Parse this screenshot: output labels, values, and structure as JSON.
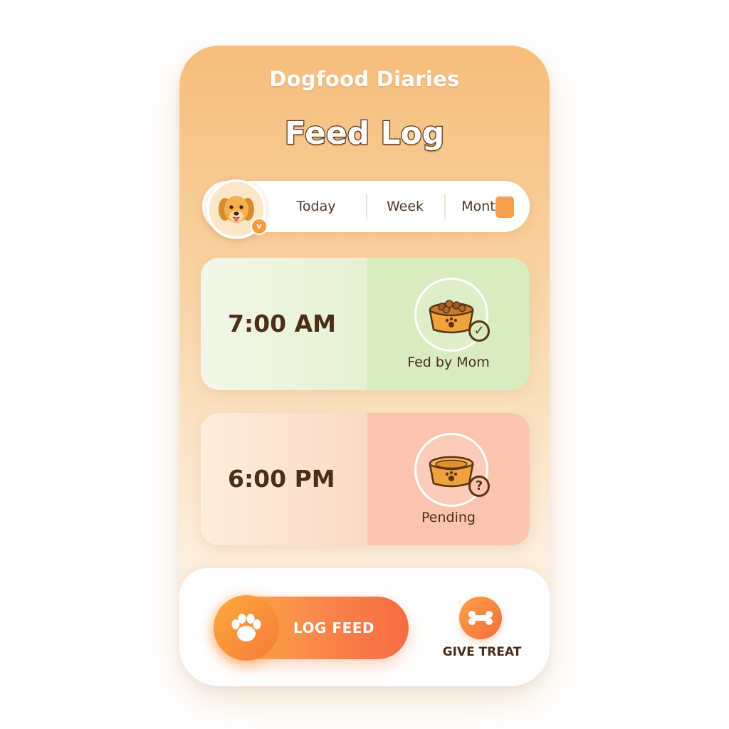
{
  "header": {
    "app_title": "Dogfood Diaries",
    "page_title": "Feed Log"
  },
  "tabs": {
    "items": [
      "Today",
      "Week",
      "Month"
    ],
    "avatar_badge": "v"
  },
  "feeds": [
    {
      "time": "7:00 AM",
      "status": "Fed by Mom",
      "status_icon": "check-icon",
      "bowl": "full-bowl-icon",
      "color": "#d8ecc0"
    },
    {
      "time": "6:00 PM",
      "status": "Pending",
      "status_icon": "question-icon",
      "bowl": "empty-bowl-icon",
      "color": "#fcc4ae"
    }
  ],
  "actions": {
    "log_feed": "LOG FEED",
    "give_treat": "GIVE TREAT"
  },
  "colors": {
    "accent": "#f4a04f",
    "primary_button": "#f9834a",
    "text_dark": "#4a2e17"
  }
}
